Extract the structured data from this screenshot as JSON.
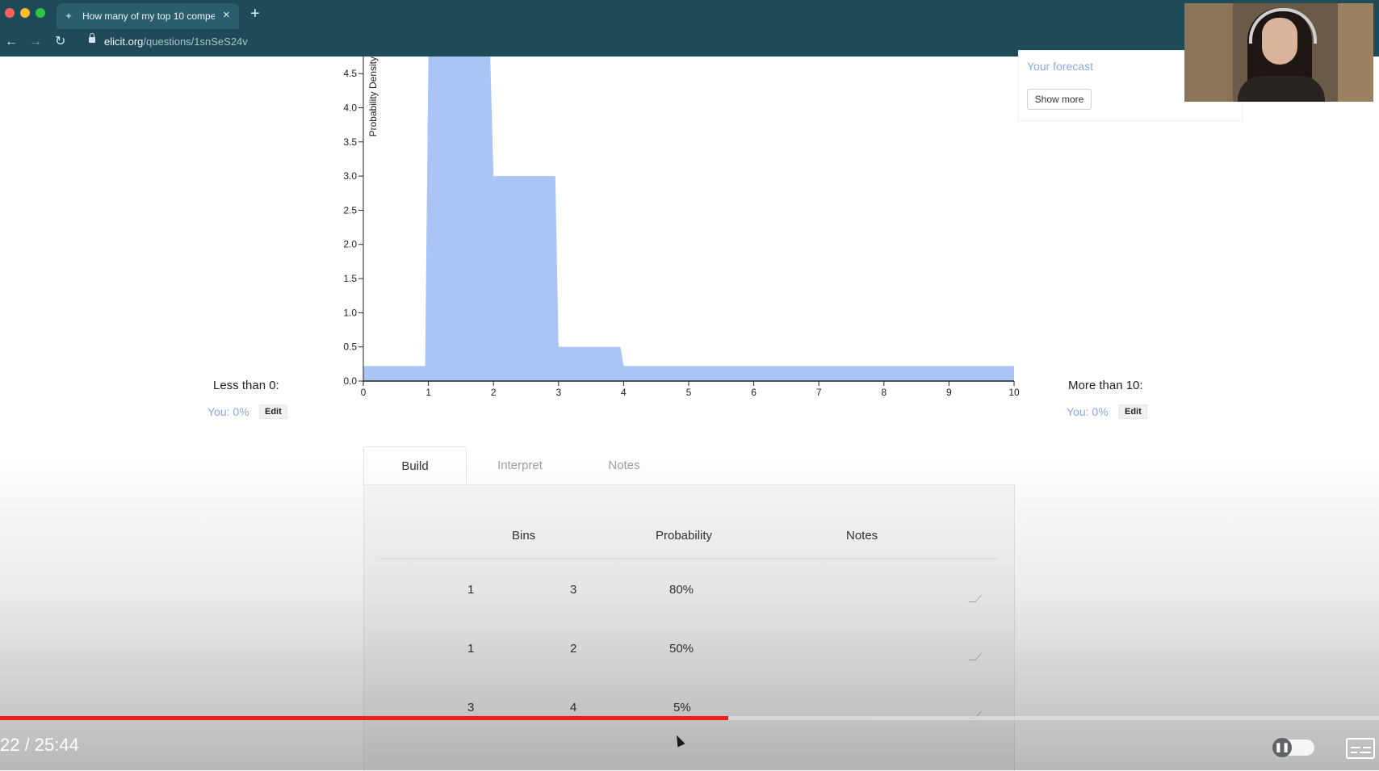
{
  "browser": {
    "tab_title": "How many of my top 10 compe",
    "tab_close_icon": "×",
    "new_tab_icon": "+",
    "url_host": "elicit.org",
    "url_path": "/questions/1snSeS24v",
    "back_icon": "←",
    "forward_icon": "→",
    "reload_icon": "↻",
    "favicon": "✦",
    "colors": {
      "chrome": "#1f4a57",
      "tab": "#2a5e6c",
      "close_dot": "#ff5f57",
      "min_dot": "#febc2e",
      "max_dot": "#28c840"
    }
  },
  "forecast_card": {
    "label": "Your forecast",
    "show_more": "Show more"
  },
  "left_bound": {
    "label": "Less than 0:",
    "you": "You: 0%",
    "edit": "Edit"
  },
  "right_bound": {
    "label": "More than 10:",
    "you": "You: 0%",
    "edit": "Edit"
  },
  "chart_data": {
    "type": "area",
    "ylabel": "Probability Density",
    "xlabel": "",
    "title": "",
    "x_ticks": [
      0,
      1,
      2,
      3,
      4,
      5,
      6,
      7,
      8,
      9,
      10
    ],
    "y_ticks": [
      0.0,
      0.5,
      1.0,
      1.5,
      2.0,
      2.5,
      3.0,
      3.5,
      4.0,
      4.5
    ],
    "xlim": [
      0,
      10
    ],
    "ylim": [
      0,
      4.75
    ],
    "y_clipped_top": true,
    "points": [
      [
        0,
        0.22
      ],
      [
        0.95,
        0.22
      ],
      [
        1.0,
        4.75
      ],
      [
        1.95,
        4.75
      ],
      [
        2.0,
        3.0
      ],
      [
        2.95,
        3.0
      ],
      [
        3.0,
        0.5
      ],
      [
        3.95,
        0.5
      ],
      [
        4.0,
        0.22
      ],
      [
        10,
        0.22
      ]
    ],
    "fill_color": "#a9c4f5",
    "axis_color": "#222222"
  },
  "tabs": [
    {
      "label": "Build",
      "active": true
    },
    {
      "label": "Interpret",
      "active": false
    },
    {
      "label": "Notes",
      "active": false
    }
  ],
  "table": {
    "headers": {
      "bins": "Bins",
      "probability": "Probability",
      "notes": "Notes"
    },
    "rows": [
      {
        "from": "1",
        "to": "3",
        "prob": "80%"
      },
      {
        "from": "1",
        "to": "2",
        "prob": "50%"
      },
      {
        "from": "3",
        "to": "4",
        "prob": "5%"
      }
    ]
  },
  "video": {
    "time": "22 / 25:44",
    "progress_fraction": 0.528,
    "buffered_fraction": 0.633,
    "pause_icon": "❚❚",
    "colors": {
      "progress": "#ee1c1c"
    }
  }
}
